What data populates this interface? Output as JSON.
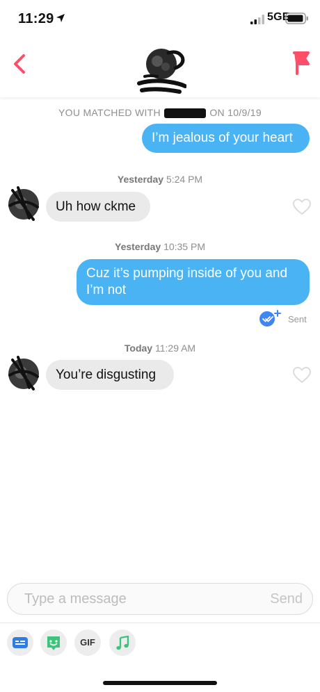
{
  "status_bar": {
    "time": "11:29",
    "network": "5GE"
  },
  "header": {
    "back_icon": "chevron-left-icon",
    "report_icon": "flag-icon"
  },
  "conversation": {
    "match_prefix": "YOU MATCHED WITH",
    "match_suffix": "ON 10/9/19",
    "messages": [
      {
        "side": "out",
        "text": "I’m jealous of your heart"
      },
      {
        "stamp_day": "Yesterday",
        "stamp_time": "5:24 PM"
      },
      {
        "side": "in",
        "text": "Uh how ckme"
      },
      {
        "stamp_day": "Yesterday",
        "stamp_time": "10:35 PM"
      },
      {
        "side": "out",
        "text": "Cuz it’s pumping inside of you and I’m not"
      },
      {
        "stamp_day": "Today",
        "stamp_time": "11:29 AM"
      },
      {
        "side": "in",
        "text": "You’re disgusting"
      }
    ],
    "read_receipt": "Sent"
  },
  "composer": {
    "placeholder": "Type a message",
    "send_label": "Send"
  },
  "toolbar": {
    "gif_label": "GIF"
  },
  "colors": {
    "accent": "#fd4f68",
    "outgoing_bubble": "#4ab3f4",
    "incoming_bubble": "#eaeaea"
  }
}
